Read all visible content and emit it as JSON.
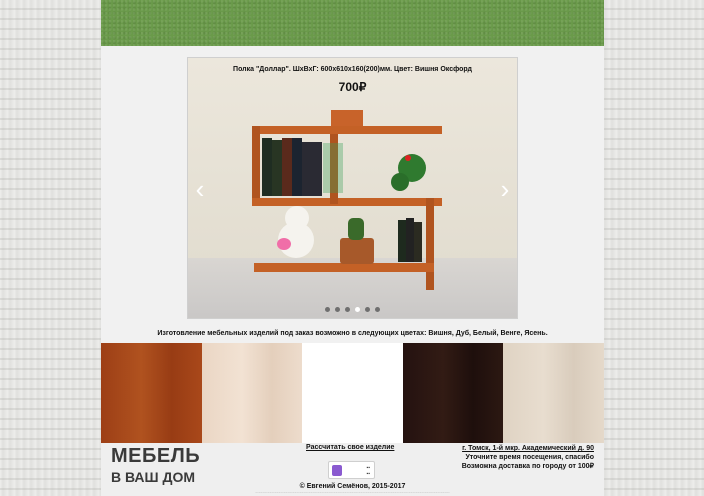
{
  "slider": {
    "caption": "Полка \"Доллар\". ШхВхГ: 600х610х160(200)мм. Цвет: Вишня Оксфорд",
    "price": "700₽",
    "prev_icon": "chevron-left-icon",
    "next_icon": "chevron-right-icon",
    "prev_glyph": "‹",
    "next_glyph": "›",
    "dots_count": 6,
    "active_dot": 3
  },
  "colors_notice": "Изготовление мебельных изделий под заказ возможно в следующих цветах: Вишня, Дуб, Белый, Венге, Ясень.",
  "swatches": [
    {
      "name": "Вишня",
      "color": "#a4461a"
    },
    {
      "name": "Дуб",
      "color": "#ecd9c8"
    },
    {
      "name": "Белый",
      "color": "#ffffff"
    },
    {
      "name": "Венге",
      "color": "#2a1610"
    },
    {
      "name": "Ясень",
      "color": "#e3d8c9"
    }
  ],
  "footer": {
    "logo_line1": "МЕБЕЛЬ",
    "logo_line2": "В ВАШ ДОМ",
    "calc_link": "Рассчитать свое изделие",
    "address_line": "г. Томск, 1-й мкр. Академический д. 90",
    "visit_note": "Уточните время посещения, спасибо",
    "delivery_note": "Возможна доставка по городу от 100₽",
    "copyright": "© Евгений Семёнов, 2015-2017",
    "widget_icon": "counter-icon"
  }
}
